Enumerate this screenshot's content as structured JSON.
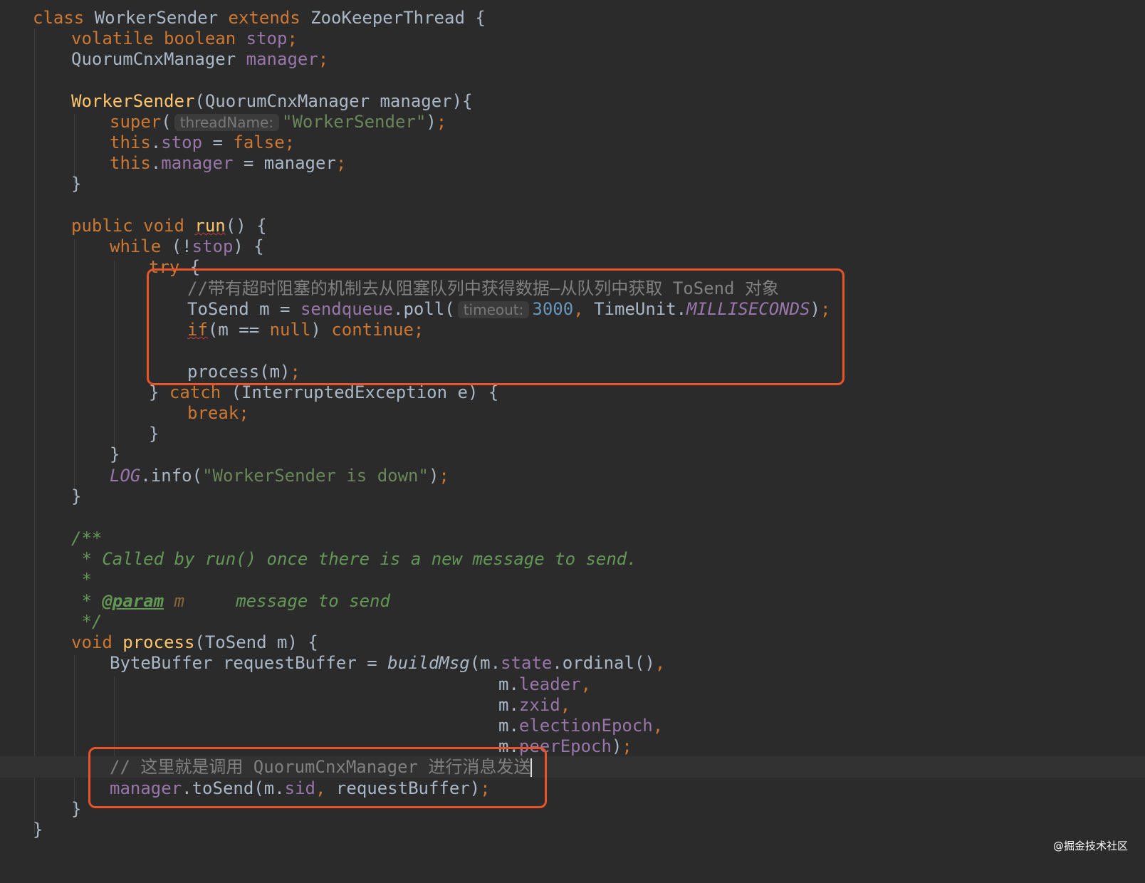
{
  "code": {
    "l1": {
      "t1": "class",
      "t2": "WorkerSender",
      "t3": "extends",
      "t4": "ZooKeeperThread",
      "t5": "{"
    },
    "l2": {
      "t1": "volatile boolean",
      "t2": "stop",
      "t3": ";"
    },
    "l3": {
      "t1": "QuorumCnxManager",
      "t2": "manager",
      "t3": ";"
    },
    "l5": {
      "t1": "WorkerSender",
      "t2": "(QuorumCnxManager manager){"
    },
    "l6": {
      "t1": "super",
      "t2": "(",
      "hint": "threadName:",
      "t3": "\"WorkerSender\"",
      "t4": ")",
      "t5": ";"
    },
    "l7": {
      "t1": "this",
      "t2": ".",
      "t3": "stop",
      "t4": " = ",
      "t5": "false",
      "t6": ";"
    },
    "l8": {
      "t1": "this",
      "t2": ".",
      "t3": "manager",
      "t4": " = manager",
      "t5": ";"
    },
    "l9": {
      "t1": "}"
    },
    "l11": {
      "t1": "public void",
      "t2": "run",
      "t3": "() {"
    },
    "l12": {
      "t1": "while",
      "t2": " (!",
      "t3": "stop",
      "t4": ") {"
    },
    "l13": {
      "t1": "try",
      "t2": " {"
    },
    "l14": {
      "t1": "//带有超时阻塞的机制去从阻塞队列中获得数据—从队列中获取 ToSend 对象"
    },
    "l15": {
      "t1": "ToSend m = ",
      "t2": "sendqueue",
      "t3": ".poll(",
      "hint": "timeout:",
      "t4": "3000",
      "t5": ",",
      "t6": " TimeUnit.",
      "t7": "MILLISECONDS",
      "t8": ")",
      "t9": ";"
    },
    "l16": {
      "t1": "if",
      "t2": "(m == ",
      "t3": "null",
      "t4": ") ",
      "t5": "continue;"
    },
    "l18": {
      "t1": "process(m)",
      "t2": ";"
    },
    "l19": {
      "t1": "} ",
      "t2": "catch",
      "t3": " (InterruptedException e) {"
    },
    "l20": {
      "t1": "break;"
    },
    "l21": {
      "t1": "}"
    },
    "l22": {
      "t1": "}"
    },
    "l23": {
      "t1": "LOG",
      "t2": ".info(",
      "t3": "\"WorkerSender is down\"",
      "t4": ")",
      "t5": ";"
    },
    "l24": {
      "t1": "}"
    },
    "l26": {
      "t1": "/**"
    },
    "l27": {
      "t1": " * Called by run() once there is a new message to send."
    },
    "l28": {
      "t1": " *"
    },
    "l29": {
      "t1": " * ",
      "t2": "@param",
      "t3": " m",
      "t4": "     message to send"
    },
    "l30": {
      "t1": " */"
    },
    "l31": {
      "t1": "void ",
      "t2": "process",
      "t3": "(ToSend m) {"
    },
    "l32": {
      "t1": "ByteBuffer requestBuffer = ",
      "t2": "buildMsg",
      "t3": "(m.",
      "t4": "state",
      "t5": ".ordinal()",
      "t6": ","
    },
    "l33": {
      "t1": "m.",
      "t2": "leader",
      "t3": ","
    },
    "l34": {
      "t1": "m.",
      "t2": "zxid",
      "t3": ","
    },
    "l35": {
      "t1": "m.",
      "t2": "electionEpoch",
      "t3": ","
    },
    "l36": {
      "t1": "m.",
      "t2": "peerEpoch",
      "t3": ")",
      "t4": ";"
    },
    "l37": {
      "t1": "// 这里就是调用 QuorumCnxManager 进行消息发送"
    },
    "l38": {
      "t1": "manager",
      "t2": ".toSend(m.",
      "t3": "sid",
      "t4": ",",
      "t5": " requestBuffer)",
      "t6": ";"
    },
    "l39": {
      "t1": "}"
    },
    "l40": {
      "t1": "}"
    }
  },
  "watermark": "@掘金技术社区",
  "colors": {
    "background": "#2b2b2b",
    "keyword": "#cc7832",
    "field": "#9876aa",
    "method": "#ffc66d",
    "string": "#6a8759",
    "number": "#6897bb",
    "comment": "#808080",
    "doc_comment": "#629755",
    "highlight_box": "#e8542a"
  }
}
